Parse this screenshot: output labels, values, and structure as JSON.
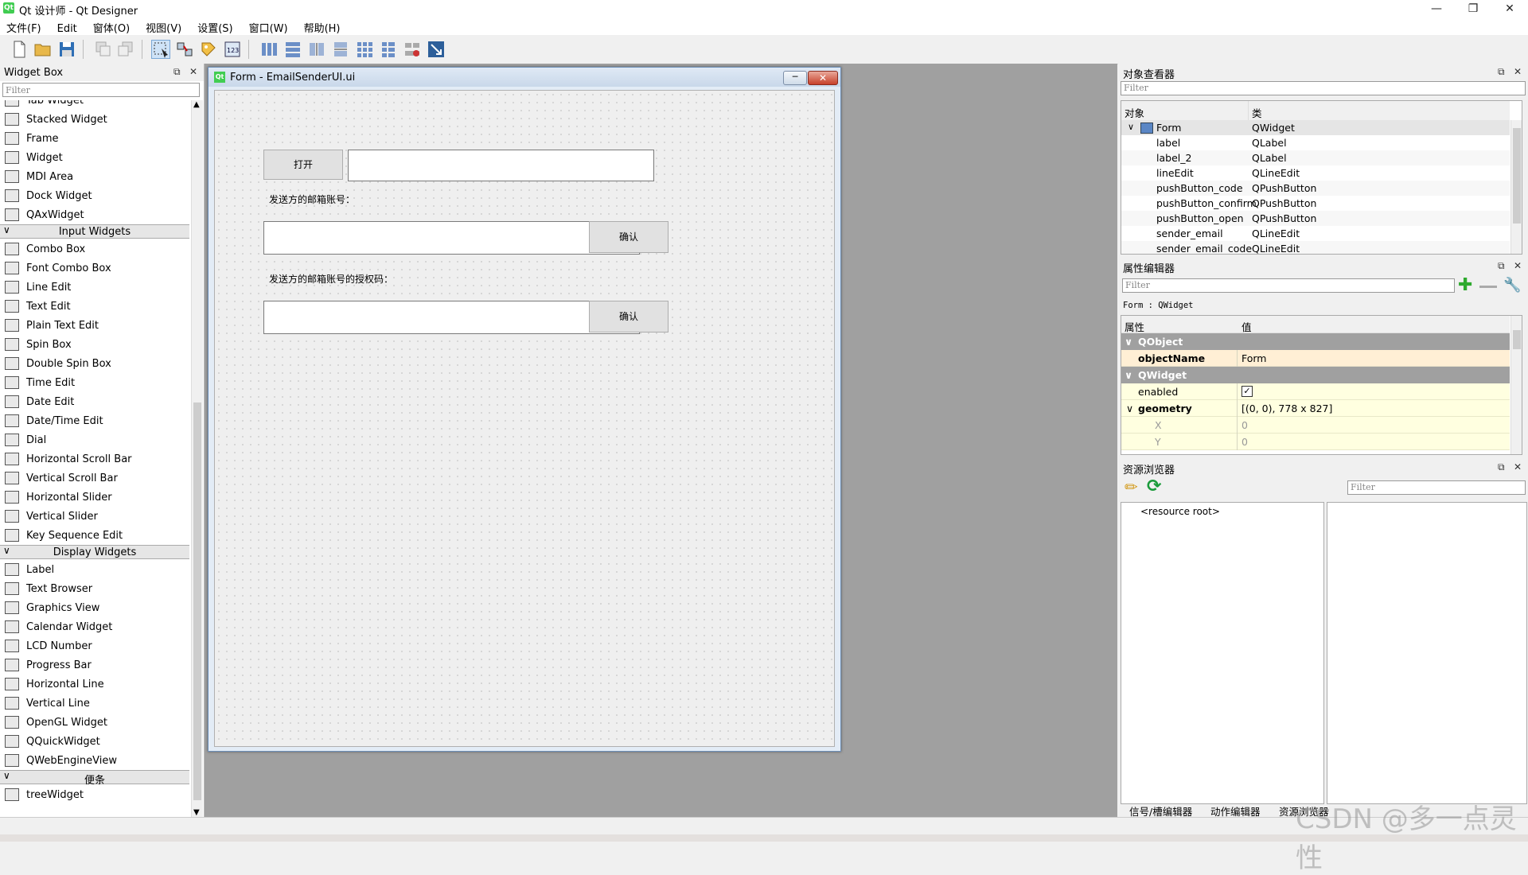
{
  "window": {
    "title": "Qt 设计师 - Qt Designer",
    "app_icon": "Qt"
  },
  "menu": [
    "文件(F)",
    "Edit",
    "窗体(O)",
    "视图(V)",
    "设置(S)",
    "窗口(W)",
    "帮助(H)"
  ],
  "widget_box": {
    "title": "Widget Box",
    "filter_placeholder": "Filter",
    "layout_items": [
      "Tab Widget",
      "Stacked Widget",
      "Frame",
      "Widget",
      "MDI Area",
      "Dock Widget",
      "QAxWidget"
    ],
    "input_category": "Input Widgets",
    "input_items": [
      "Combo Box",
      "Font Combo Box",
      "Line Edit",
      "Text Edit",
      "Plain Text Edit",
      "Spin Box",
      "Double Spin Box",
      "Time Edit",
      "Date Edit",
      "Date/Time Edit",
      "Dial",
      "Horizontal Scroll Bar",
      "Vertical Scroll Bar",
      "Horizontal Slider",
      "Vertical Slider",
      "Key Sequence Edit"
    ],
    "display_category": "Display Widgets",
    "display_items": [
      "Label",
      "Text Browser",
      "Graphics View",
      "Calendar Widget",
      "LCD Number",
      "Progress Bar",
      "Horizontal Line",
      "Vertical Line",
      "OpenGL Widget",
      "QQuickWidget",
      "QWebEngineView"
    ],
    "misc_category": "便条",
    "misc_items": [
      "treeWidget"
    ]
  },
  "form": {
    "title": "Form - EmailSenderUI.ui",
    "open_button": "打开",
    "email_label": "发送方的邮箱账号：",
    "code_label": "发送方的邮箱账号的授权码：",
    "confirm_button_1": "确认",
    "confirm_button_2": "确认"
  },
  "object_inspector": {
    "title": "对象查看器",
    "filter_placeholder": "Filter",
    "col_object": "对象",
    "col_class": "类",
    "rows": [
      {
        "name": "Form",
        "cls": "QWidget"
      },
      {
        "name": "label",
        "cls": "QLabel"
      },
      {
        "name": "label_2",
        "cls": "QLabel"
      },
      {
        "name": "lineEdit",
        "cls": "QLineEdit"
      },
      {
        "name": "pushButton_code",
        "cls": "QPushButton"
      },
      {
        "name": "pushButton_confirm",
        "cls": "QPushButton"
      },
      {
        "name": "pushButton_open",
        "cls": "QPushButton"
      },
      {
        "name": "sender_email",
        "cls": "QLineEdit"
      },
      {
        "name": "sender_email_code",
        "cls": "QLineEdit"
      }
    ]
  },
  "property_editor": {
    "title": "属性编辑器",
    "filter_placeholder": "Filter",
    "context": "Form : QWidget",
    "col_property": "属性",
    "col_value": "值",
    "group_qobject": "QObject",
    "objectName_label": "objectName",
    "objectName_value": "Form",
    "group_qwidget": "QWidget",
    "enabled_label": "enabled",
    "geometry_label": "geometry",
    "geometry_value": "[(0, 0), 778 x 827]",
    "x_label": "X",
    "x_value": "0",
    "y_label": "Y",
    "y_value": "0"
  },
  "resource_browser": {
    "title": "资源浏览器",
    "filter_placeholder": "Filter",
    "root": "<resource root>"
  },
  "bottom_tabs": [
    "信号/槽编辑器",
    "动作编辑器",
    "资源浏览器"
  ],
  "watermark": "CSDN @多一点灵性",
  "colors": {
    "qt_green": "#41cd52",
    "mdi_bg": "#a0a0a0",
    "group_header": "#a0a0a0",
    "property_yellow": "#ffffe0"
  }
}
